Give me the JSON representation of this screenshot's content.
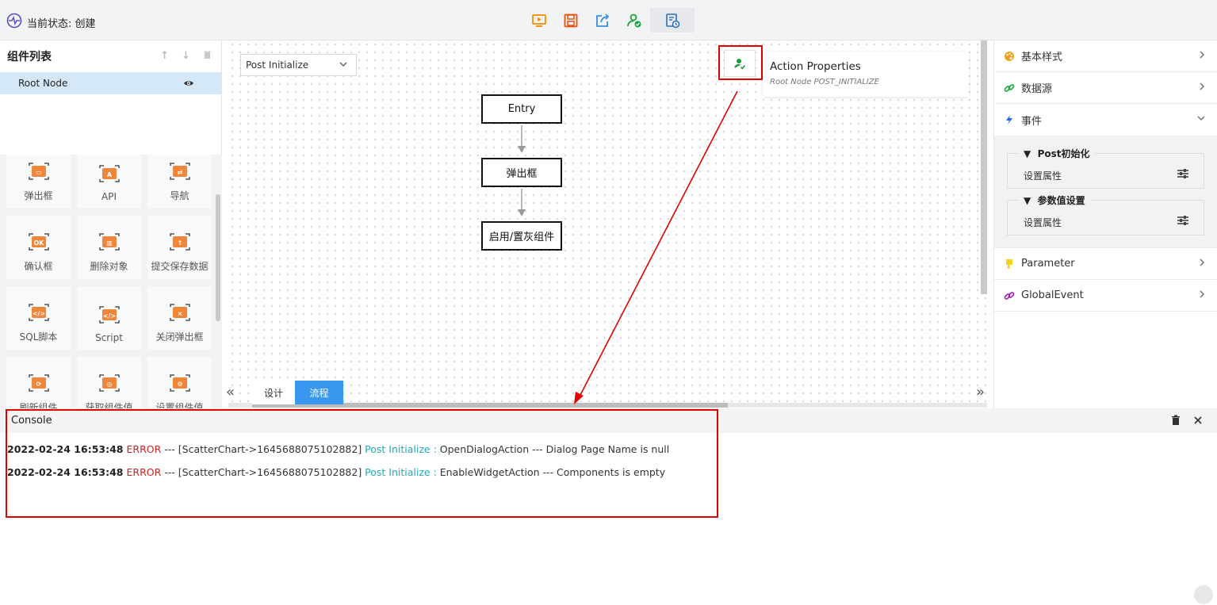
{
  "header": {
    "status_text": "当前状态: 创建",
    "toolbar": [
      {
        "name": "preview-icon",
        "color": "#f08c00"
      },
      {
        "name": "save-icon",
        "color": "#e8510c"
      },
      {
        "name": "export-icon",
        "color": "#3a8de0"
      },
      {
        "name": "publish-icon",
        "color": "#1aa33c"
      },
      {
        "name": "schedule-icon",
        "color": "#2a6fb8"
      }
    ]
  },
  "left_panel": {
    "title": "组件列表",
    "tree": [
      {
        "label": "Root Node"
      }
    ],
    "components": [
      {
        "label": "弹出框"
      },
      {
        "label": "API"
      },
      {
        "label": "导航"
      },
      {
        "label": "确认框"
      },
      {
        "label": "删除对象"
      },
      {
        "label": "提交保存数据"
      },
      {
        "label": "SQL脚本"
      },
      {
        "label": "Script"
      },
      {
        "label": "关闭弹出框"
      },
      {
        "label": "刷新组件"
      },
      {
        "label": "获取组件值"
      },
      {
        "label": "设置组件值"
      }
    ],
    "accent_color": "#f0863a"
  },
  "canvas": {
    "event_select": "Post Initialize",
    "nodes": [
      "Entry",
      "弹出框",
      "启用/置灰组件"
    ],
    "props_card": {
      "title": "Action Properties",
      "subtitle": "Root Node POST_INITIALIZE"
    },
    "tabs": [
      {
        "label": "设计"
      },
      {
        "label": "流程"
      }
    ],
    "active_tab": "流程"
  },
  "right_panel": {
    "sections": [
      {
        "label": "基本样式",
        "icon": "palette-icon"
      },
      {
        "label": "数据源",
        "icon": "link-icon"
      },
      {
        "label": "事件",
        "icon": "lightning-icon"
      }
    ],
    "events": [
      {
        "name": "Post初始化",
        "prop": "设置属性"
      },
      {
        "name": "参数值设置",
        "prop": "设置属性"
      }
    ],
    "sections_after": [
      {
        "label": "Parameter",
        "icon": "flag-icon"
      },
      {
        "label": "GlobalEvent",
        "icon": "link-icon"
      }
    ]
  },
  "console": {
    "title": "Console",
    "logs": [
      {
        "time": "2022-02-24 16:53:48",
        "level": "ERROR",
        "sep": " --- [ScatterChart->1645688075102882] ",
        "event": "Post Initialize :",
        "message": " OpenDialogAction --- Dialog Page Name is null"
      },
      {
        "time": "2022-02-24 16:53:48",
        "level": "ERROR",
        "sep": " --- [ScatterChart->1645688075102882] ",
        "event": "Post Initialize :",
        "message": " EnableWidgetAction --- Components is empty"
      }
    ]
  },
  "colors": {
    "highlight": "#e00000",
    "active_tab": "#3a97ee",
    "selected_row": "#d5e8f8"
  }
}
